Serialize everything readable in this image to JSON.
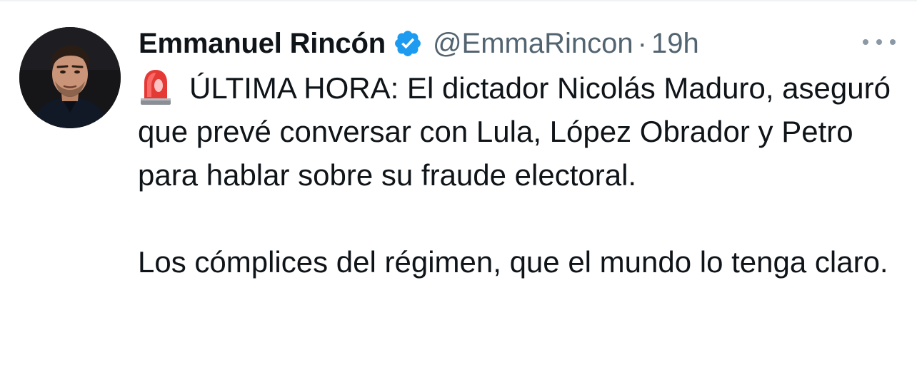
{
  "tweet": {
    "author_name": "Emmanuel Rincón",
    "handle": "@EmmaRincon",
    "separator": "·",
    "timestamp": "19h",
    "verified": true,
    "paragraph_1": "ÚLTIMA HORA: El dictador Nicolás Maduro, aseguró que prevé conversar con Lula, López Obrador y Petro para hablar sobre su fraude electoral.",
    "paragraph_2": "Los cómplices del régimen, que el mundo lo tenga claro.",
    "leading_emoji": "police-car-light-icon"
  },
  "icons": {
    "verified": "verified-badge-icon",
    "more": "more-options-icon"
  },
  "colors": {
    "text_primary": "#0f1419",
    "text_secondary": "#536471",
    "verified_blue": "#1d9bf0",
    "siren_red": "#e53935"
  }
}
